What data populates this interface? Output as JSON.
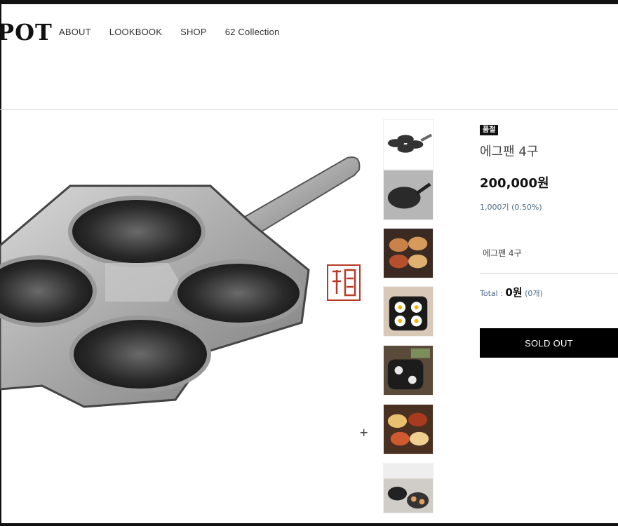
{
  "logo": {
    "text": "POT"
  },
  "nav": {
    "items": [
      "ABOUT",
      "LOOKBOOK",
      "SHOP",
      "62 Collection"
    ]
  },
  "product": {
    "badge": "품절",
    "name": "에그팬 4구",
    "price": "200,000원",
    "points": "1,000기 (0.50%)",
    "option": "에그팬 4구",
    "total_label": "Total : ",
    "total_amount": "0원",
    "total_count": " (0개)",
    "soldout_label": "SOLD OUT"
  },
  "icons": {
    "zoom": "+"
  },
  "colors": {
    "button_bg": "#000000",
    "badge_bg": "#111111",
    "points_text": "#4a6b8a"
  }
}
